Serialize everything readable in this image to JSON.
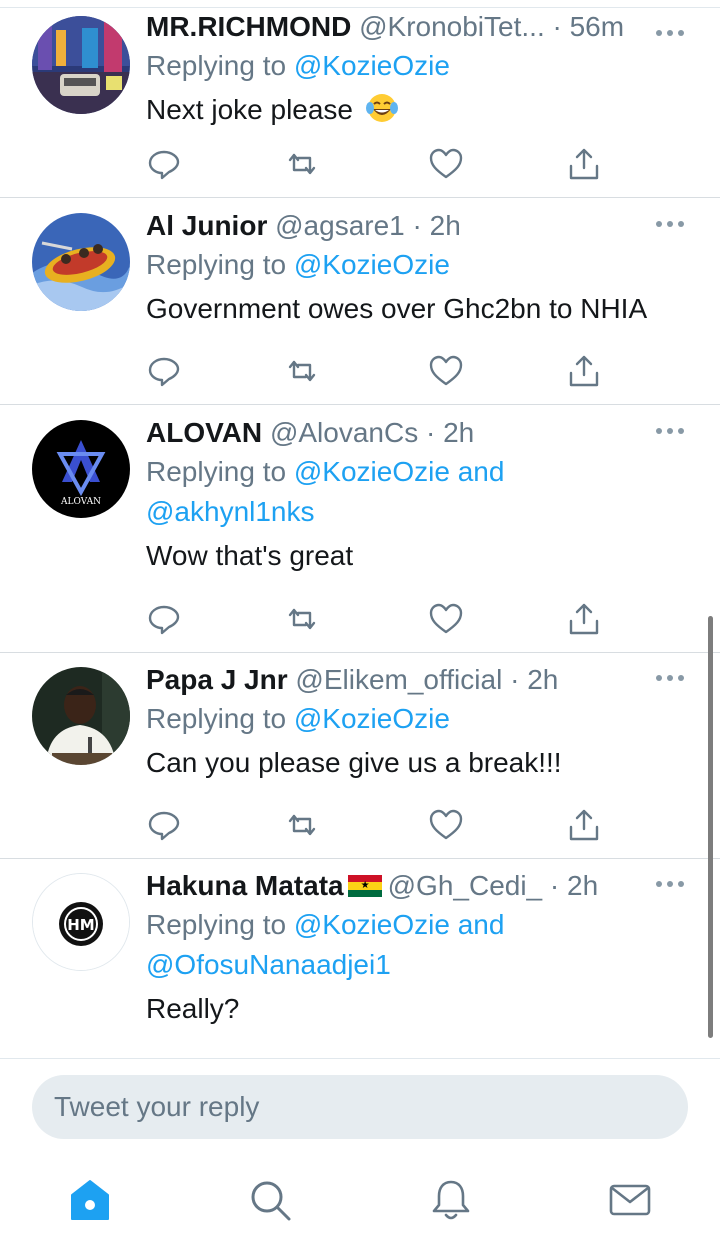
{
  "tweets": [
    {
      "name": "MR.RICHMOND",
      "handle": "@KronobiTet...",
      "dot": "·",
      "time": "56m",
      "replying_prefix": "Replying to",
      "mentions_line1": "@KozieOzie",
      "conjunction": "",
      "mentions_line2": "",
      "text": "Next joke please",
      "emoji": "face-with-tears-of-joy",
      "flag": ""
    },
    {
      "name": "Al Junior",
      "handle": "@agsare1",
      "dot": "·",
      "time": "2h",
      "replying_prefix": "Replying to",
      "mentions_line1": "@KozieOzie",
      "conjunction": "",
      "mentions_line2": "",
      "text": "Government owes over Ghc2bn to NHIA"
    },
    {
      "name": "ALOVAN",
      "handle": "@AlovanCs",
      "dot": "·",
      "time": "2h",
      "replying_prefix": "Replying to",
      "mentions_line1": "@KozieOzie",
      "conjunction": "and",
      "mentions_line2": "@akhynl1nks",
      "text": "Wow that's great",
      "avatar_label": "ALOVAN"
    },
    {
      "name": "Papa J Jnr",
      "handle": "@Elikem_official",
      "dot": "·",
      "time": "2h",
      "replying_prefix": "Replying to",
      "mentions_line1": "@KozieOzie",
      "conjunction": "",
      "mentions_line2": "",
      "text": "Can you please give us a break!!!"
    },
    {
      "name": "Hakuna Matata",
      "handle": "@Gh_Cedi_",
      "dot": "·",
      "time": "2h",
      "replying_prefix": "Replying to",
      "mentions_line1": "@KozieOzie",
      "conjunction": "and",
      "mentions_line2": "@OfosuNanaadjei1",
      "text": "Really?",
      "flag": "ghana-flag",
      "avatar_label": "HM"
    }
  ],
  "actions": [
    "reply-icon",
    "retweet-icon",
    "like-icon",
    "share-icon"
  ],
  "composer": {
    "placeholder": "Tweet your reply"
  },
  "tabbar": [
    "home-icon",
    "search-icon",
    "notifications-icon",
    "messages-icon"
  ],
  "colors": {
    "accent": "#1da1f2",
    "muted": "#657786",
    "text": "#14171a",
    "divider": "#d8dde1",
    "reply_box": "#e6ecf0"
  }
}
